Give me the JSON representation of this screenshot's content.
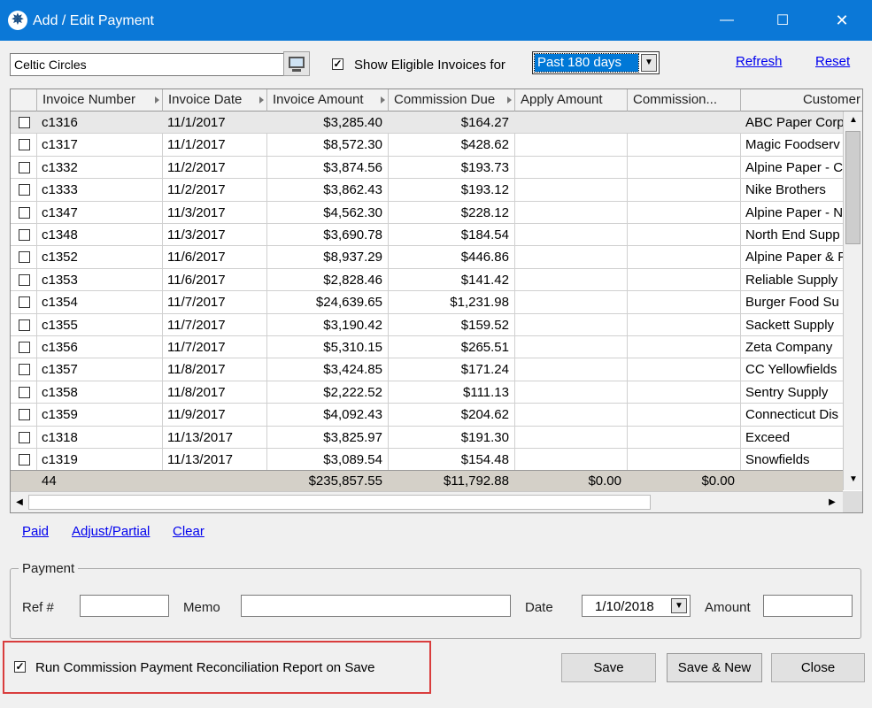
{
  "window": {
    "title": "Add / Edit Payment",
    "minimize_glyph": "—",
    "maximize_glyph": "☐",
    "close_glyph": "✕",
    "app_icon": "compass-rose-icon"
  },
  "filter": {
    "customer_value": "Celtic Circles",
    "show_eligible_checked": true,
    "show_eligible_label": "Show Eligible Invoices for",
    "period_selected": "Past 180 days",
    "refresh_label": "Refresh",
    "reset_label": "Reset",
    "lookup_icon": "computer-lookup-icon"
  },
  "grid": {
    "columns": [
      "Invoice Number",
      "Invoice Date",
      "Invoice Amount",
      "Commission Due",
      "Apply Amount",
      "Commission...",
      "Customer"
    ],
    "rows": [
      {
        "inv": "c1316",
        "date": "11/1/2017",
        "amount": "$3,285.40",
        "comm": "$164.27",
        "customer": "ABC Paper Corp"
      },
      {
        "inv": "c1317",
        "date": "11/1/2017",
        "amount": "$8,572.30",
        "comm": "$428.62",
        "customer": "Magic Foodserv"
      },
      {
        "inv": "c1332",
        "date": "11/2/2017",
        "amount": "$3,874.56",
        "comm": "$193.73",
        "customer": "Alpine Paper - C"
      },
      {
        "inv": "c1333",
        "date": "11/2/2017",
        "amount": "$3,862.43",
        "comm": "$193.12",
        "customer": "Nike Brothers"
      },
      {
        "inv": "c1347",
        "date": "11/3/2017",
        "amount": "$4,562.30",
        "comm": "$228.12",
        "customer": "Alpine Paper - N"
      },
      {
        "inv": "c1348",
        "date": "11/3/2017",
        "amount": "$3,690.78",
        "comm": "$184.54",
        "customer": "North End Supp"
      },
      {
        "inv": "c1352",
        "date": "11/6/2017",
        "amount": "$8,937.29",
        "comm": "$446.86",
        "customer": "Alpine Paper & F"
      },
      {
        "inv": "c1353",
        "date": "11/6/2017",
        "amount": "$2,828.46",
        "comm": "$141.42",
        "customer": "Reliable Supply"
      },
      {
        "inv": "c1354",
        "date": "11/7/2017",
        "amount": "$24,639.65",
        "comm": "$1,231.98",
        "customer": "Burger Food Su"
      },
      {
        "inv": "c1355",
        "date": "11/7/2017",
        "amount": "$3,190.42",
        "comm": "$159.52",
        "customer": "Sackett Supply"
      },
      {
        "inv": "c1356",
        "date": "11/7/2017",
        "amount": "$5,310.15",
        "comm": "$265.51",
        "customer": "Zeta Company"
      },
      {
        "inv": "c1357",
        "date": "11/8/2017",
        "amount": "$3,424.85",
        "comm": "$171.24",
        "customer": "CC Yellowfields"
      },
      {
        "inv": "c1358",
        "date": "11/8/2017",
        "amount": "$2,222.52",
        "comm": "$111.13",
        "customer": "Sentry Supply"
      },
      {
        "inv": "c1359",
        "date": "11/9/2017",
        "amount": "$4,092.43",
        "comm": "$204.62",
        "customer": "Connecticut Dis"
      },
      {
        "inv": "c1318",
        "date": "11/13/2017",
        "amount": "$3,825.97",
        "comm": "$191.30",
        "customer": "Exceed"
      },
      {
        "inv": "c1319",
        "date": "11/13/2017",
        "amount": "$3,089.54",
        "comm": "$154.48",
        "customer": "Snowfields"
      }
    ],
    "totals": {
      "count": "44",
      "amount": "$235,857.55",
      "comm": "$11,792.88",
      "apply": "$0.00",
      "commission_paid": "$0.00"
    }
  },
  "actions": {
    "paid_label": "Paid",
    "adjust_label": "Adjust/Partial",
    "clear_label": "Clear"
  },
  "payment": {
    "group_label": "Payment",
    "ref_label": "Ref #",
    "ref_value": "",
    "memo_label": "Memo",
    "memo_value": "",
    "date_label": "Date",
    "date_value": "1/10/2018",
    "amount_label": "Amount",
    "amount_value": ""
  },
  "footer": {
    "run_report_checked": true,
    "run_report_label": "Run Commission Payment Reconciliation Report on Save",
    "save_label": "Save",
    "save_new_label": "Save & New",
    "close_label": "Close"
  },
  "colors": {
    "titlebar": "#0b78d7",
    "link": "#0000ee",
    "highlight_box": "#d93d3d",
    "total_row": "#d4d0c8"
  }
}
